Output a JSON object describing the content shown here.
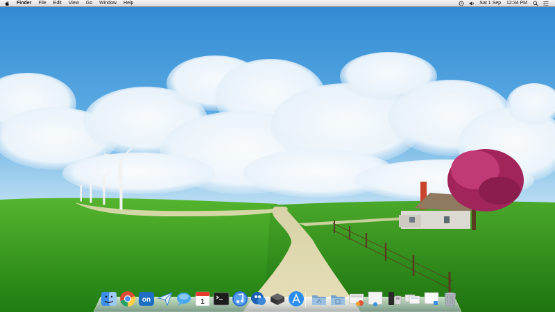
{
  "menubar": {
    "app_name": "Finder",
    "menus": [
      "File",
      "Edit",
      "View",
      "Go",
      "Window",
      "Help"
    ],
    "clock": {
      "date": "Sat 1 Sep",
      "time": "12:34 PM"
    },
    "status_icons": [
      "time-machine-icon",
      "volume-icon",
      "spotlight-search-icon",
      "notification-center-icon"
    ]
  },
  "dock": {
    "apps": [
      {
        "name": "finder-icon",
        "color": "#3d8ee8"
      },
      {
        "name": "chrome-icon",
        "color": "#dd4b39"
      },
      {
        "name": "on-app-icon",
        "label": "on",
        "color": "#1e6fc4"
      },
      {
        "name": "sparrow-mail-icon",
        "color": "#2f7fd6"
      },
      {
        "name": "messages-icon",
        "color": "#4aa8f0"
      },
      {
        "name": "calendar-icon",
        "label": "1",
        "color": "#e83a2f"
      },
      {
        "name": "terminal-icon",
        "color": "#1c1c1c"
      },
      {
        "name": "itunes-icon",
        "color": "#2a6fd1"
      },
      {
        "name": "tweetbot-icon",
        "color": "#1d5fb0"
      },
      {
        "name": "drive-icon",
        "color": "#444444"
      },
      {
        "name": "app-store-icon",
        "color": "#2b8df0"
      }
    ],
    "stacks": [
      {
        "name": "applications-folder-icon",
        "color": "#7aa3c8"
      },
      {
        "name": "documents-folder-icon",
        "color": "#7aa3c8"
      },
      {
        "name": "downloads-stack-icon",
        "color": "#cfcfcf"
      },
      {
        "name": "preview-window-icon",
        "color": "#e8e8e8"
      },
      {
        "name": "mac-pro-icon",
        "color": "#333333"
      },
      {
        "name": "screenshots-stack-icon",
        "color": "#dcdcdc"
      },
      {
        "name": "text-document-icon",
        "color": "#f2f2f2"
      },
      {
        "name": "trash-icon",
        "color": "#9aa0a6"
      }
    ]
  }
}
